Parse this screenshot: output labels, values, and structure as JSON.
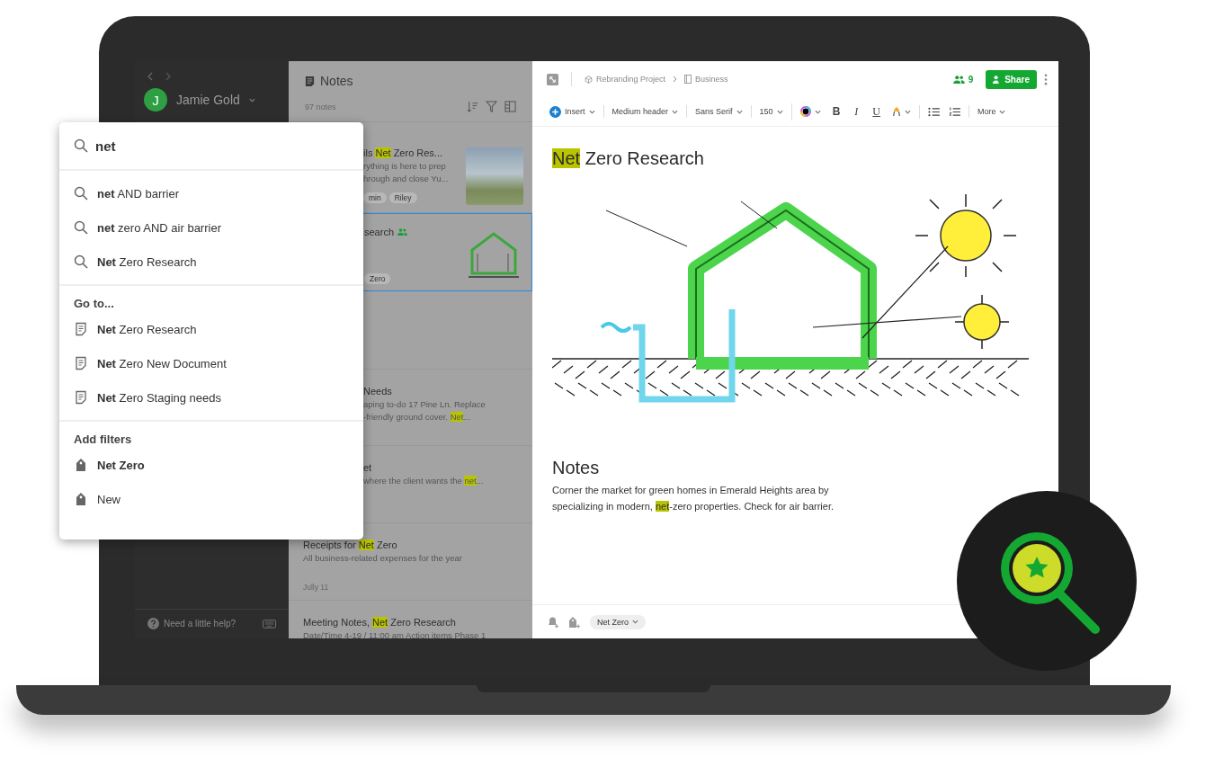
{
  "sidebar": {
    "avatar_initial": "J",
    "user_name": "Jamie Gold",
    "help": "Need a little help?"
  },
  "notes_panel": {
    "title": "Notes",
    "count": "97 notes",
    "notes": [
      {
        "kind": "photo",
        "title": "ils **Net** Zero Res...",
        "lines": [
          "rything is here to prep",
          "hrough and close Yu..."
        ],
        "tags": [
          "min",
          "Riley"
        ],
        "shared": false,
        "selected": false,
        "partly_hidden": true
      },
      {
        "kind": "sketch",
        "title": "search",
        "tags": [
          "Zero"
        ],
        "shared": true,
        "selected": true,
        "partly_hidden": true
      },
      {
        "kind": "text",
        "title": "Needs",
        "lines": [
          "aping to-do 17 Pine Ln. Replace",
          "-friendly ground cover. **Net**..."
        ],
        "shared": false,
        "selected": false,
        "partly_hidden": true
      },
      {
        "kind": "text",
        "title": "et",
        "lines": [
          "where the client wants the **net**..."
        ],
        "shared": false,
        "selected": false,
        "partly_hidden": true
      },
      {
        "kind": "text",
        "title": "Receipts for **Net** Zero",
        "lines": [
          "All business-related expenses for the year"
        ],
        "date": "Jully 11",
        "shared": false,
        "selected": false,
        "partly_hidden": false
      },
      {
        "kind": "text",
        "title": "Meeting Notes, **Net** Zero Research",
        "lines": [
          "Date/Time 4-19 / 11:00 am Action items Phase 1"
        ],
        "shared": false,
        "selected": false,
        "partly_hidden": false
      }
    ]
  },
  "editor": {
    "breadcrumb": [
      "Rebranding Project",
      "Business"
    ],
    "shared_count": "9",
    "share_label": "Share",
    "toolbar_groups": [
      [
        {
          "kind": "insert",
          "label": "Insert"
        }
      ],
      [
        {
          "kind": "dropdown",
          "label": "Medium header"
        }
      ],
      [
        {
          "kind": "dropdown",
          "label": "Sans Serif"
        }
      ],
      [
        {
          "kind": "dropdown",
          "label": "150"
        }
      ],
      [
        {
          "kind": "color"
        },
        {
          "kind": "bold",
          "label": "B"
        },
        {
          "kind": "italic",
          "label": "I"
        },
        {
          "kind": "underline",
          "label": "U"
        },
        {
          "kind": "highlight"
        }
      ],
      [
        {
          "kind": "bullets"
        },
        {
          "kind": "numbered"
        }
      ],
      [
        {
          "kind": "dropdown",
          "label": "More"
        }
      ]
    ],
    "title": "**Net** Zero Research",
    "section_heading": "Notes",
    "paragraph": "Corner the market for green homes in Emerald Heights area by specializing in modern, **net**-zero properties. Check for air barrier.",
    "tag": "Net Zero"
  },
  "search_popup": {
    "query": "net",
    "suggestions": [
      "**net** AND barrier",
      "**net** zero AND air barrier",
      "**Net** Zero Research"
    ],
    "goto_heading": "Go to...",
    "goto": [
      "**Net** Zero Research",
      "**Net** Zero New Document",
      "**Net** Zero Staging needs"
    ],
    "filters_heading": "Add filters",
    "filters": [
      {
        "label": "Net Zero",
        "bold": true
      },
      {
        "label": "New",
        "bold": false
      }
    ]
  }
}
